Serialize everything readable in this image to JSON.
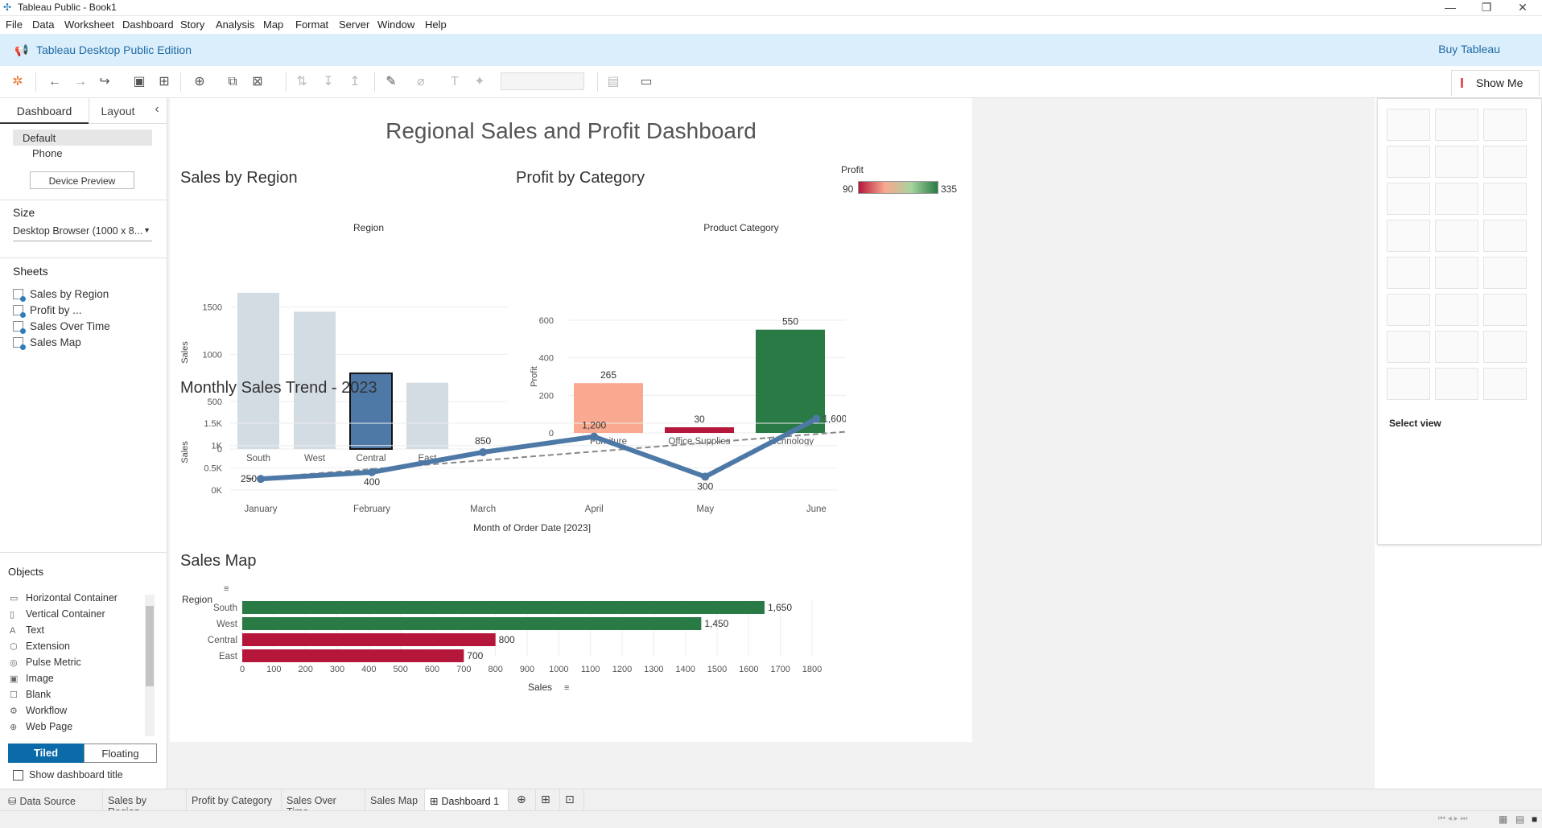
{
  "window": {
    "title": "Tableau Public - Book1",
    "minimize": "—",
    "maximize": "❐",
    "close": "✕"
  },
  "menu": [
    "File",
    "Data",
    "Worksheet",
    "Dashboard",
    "Story",
    "Analysis",
    "Map",
    "Format",
    "Server",
    "Window",
    "Help"
  ],
  "banner": {
    "edition": "Tableau Desktop Public Edition",
    "buy": "Buy Tableau"
  },
  "showme": {
    "label": "Show Me",
    "select_view": "Select view"
  },
  "left": {
    "tab_dashboard": "Dashboard",
    "tab_layout": "Layout",
    "collapse": "‹",
    "device_default": "Default",
    "device_phone": "Phone",
    "device_preview": "Device Preview",
    "size_heading": "Size",
    "size_value": "Desktop Browser (1000 x 8...",
    "sheets_heading": "Sheets",
    "sheets": [
      "Sales by Region",
      "Profit by ...",
      "Sales Over Time",
      "Sales Map"
    ],
    "objects_heading": "Objects",
    "objects": [
      {
        "icon": "▭",
        "label": "Horizontal Container"
      },
      {
        "icon": "▯",
        "label": "Vertical Container"
      },
      {
        "icon": "A",
        "label": "Text"
      },
      {
        "icon": "⬡",
        "label": "Extension"
      },
      {
        "icon": "◎",
        "label": "Pulse Metric"
      },
      {
        "icon": "▣",
        "label": "Image"
      },
      {
        "icon": "☐",
        "label": "Blank"
      },
      {
        "icon": "⚙",
        "label": "Workflow"
      },
      {
        "icon": "⊕",
        "label": "Web Page"
      }
    ],
    "tiled": "Tiled",
    "floating": "Floating",
    "show_title": "Show dashboard title"
  },
  "dashboard": {
    "title": "Regional Sales and Profit Dashboard",
    "sheet1_title": "Sales by Region",
    "sheet2_title": "Profit by Category",
    "sheet3_title": "Monthly Sales Trend - 2023",
    "sheet4_title": "Sales Map"
  },
  "legend": {
    "title": "Profit",
    "min": "90",
    "max": "335"
  },
  "colors": {
    "accent": "#0b6aa8",
    "selected_bar": "#4e79a7",
    "muted_bar": "#d3dbe3",
    "green": "#2a7a45",
    "red": "#b5173b",
    "salmon": "#f9a98f",
    "line": "#4e79a7"
  },
  "chart_data": [
    {
      "type": "bar",
      "title": "Sales by Region",
      "header": "Region",
      "categories": [
        "South",
        "West",
        "Central",
        "East"
      ],
      "values": [
        1650,
        1450,
        800,
        700
      ],
      "ylabel": "Sales",
      "yticks": [
        0,
        500,
        1000,
        1500
      ],
      "ylim": [
        0,
        1700
      ],
      "highlighted": "Central"
    },
    {
      "type": "bar",
      "title": "Profit by Category",
      "header": "Product Category",
      "categories": [
        "Furniture",
        "Office Supplies",
        "Technology"
      ],
      "values": [
        265,
        30,
        550
      ],
      "data_labels": [
        "265",
        "30",
        "550"
      ],
      "ylabel": "Profit",
      "yticks": [
        0,
        200,
        400,
        600
      ],
      "ylim": [
        0,
        600
      ]
    },
    {
      "type": "line",
      "title": "Monthly Sales Trend - 2023",
      "categories": [
        "January",
        "February",
        "March",
        "April",
        "May",
        "June"
      ],
      "values": [
        250,
        400,
        850,
        1200,
        300,
        1600
      ],
      "data_labels": [
        "250",
        "400",
        "850",
        "1,200",
        "300",
        "1,600"
      ],
      "ylabel": "Sales",
      "xlabel": "Month of Order Date [2023]",
      "yticks": [
        "0K",
        "0.5K",
        "1K",
        "1.5K"
      ],
      "ylim": [
        0,
        1700
      ],
      "trend_line": true
    },
    {
      "type": "bar",
      "orientation": "horizontal",
      "title": "Sales Map",
      "header": "Region",
      "categories": [
        "South",
        "West",
        "Central",
        "East"
      ],
      "values": [
        1650,
        1450,
        800,
        700
      ],
      "data_labels": [
        "1,650",
        "1,450",
        "800",
        "700"
      ],
      "xlabel": "Sales",
      "xticks": [
        0,
        100,
        200,
        300,
        400,
        500,
        600,
        700,
        800,
        900,
        1000,
        1100,
        1200,
        1300,
        1400,
        1500,
        1600,
        1700,
        1800
      ],
      "xlim": [
        0,
        1800
      ]
    }
  ],
  "tabs": [
    "Data Source",
    "Sales by Region",
    "Profit by Category",
    "Sales Over Time",
    "Sales Map",
    "Dashboard 1"
  ]
}
